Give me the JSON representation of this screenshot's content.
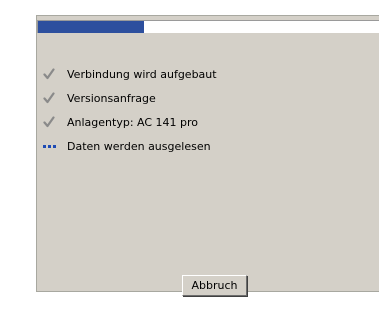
{
  "progress": {
    "fraction": 0.31,
    "color": "#2d4f9e"
  },
  "steps": [
    {
      "label": "Verbindung wird aufgebaut",
      "status": "done",
      "icon": "checkmark-icon"
    },
    {
      "label": "Versionsanfrage",
      "status": "done",
      "icon": "checkmark-icon"
    },
    {
      "label": "Anlagentyp: AC 141 pro",
      "status": "done",
      "icon": "checkmark-icon"
    },
    {
      "label": "Daten werden ausgelesen",
      "status": "in-progress",
      "icon": "dots-icon"
    }
  ],
  "cancel_button": {
    "label": "Abbruch"
  }
}
